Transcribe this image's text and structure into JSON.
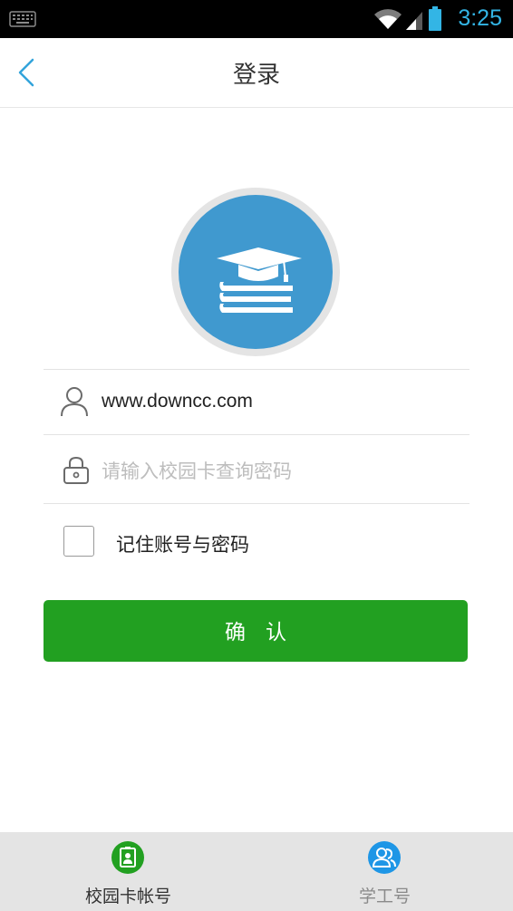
{
  "status_bar": {
    "time": "3:25",
    "icons": [
      "keyboard-icon",
      "wifi-icon",
      "signal-icon",
      "battery-icon"
    ]
  },
  "header": {
    "title": "登录",
    "back_icon": "chevron-left-icon"
  },
  "logo": {
    "icon": "graduation-books-icon"
  },
  "form": {
    "account_value": "www.downcc.com",
    "password_placeholder": "请输入校园卡查询密码",
    "remember_label": "记住账号与密码",
    "confirm_label": "确认"
  },
  "bottom_nav": {
    "items": [
      {
        "label": "校园卡帐号",
        "icon": "campus-card-icon",
        "active": true
      },
      {
        "label": "学工号",
        "icon": "staff-id-icon",
        "active": false
      }
    ]
  },
  "colors": {
    "accent": "#33b5e5",
    "primary_button": "#22a021",
    "logo_background": "#4099cf",
    "bottom_nav_background": "#e4e4e4"
  }
}
